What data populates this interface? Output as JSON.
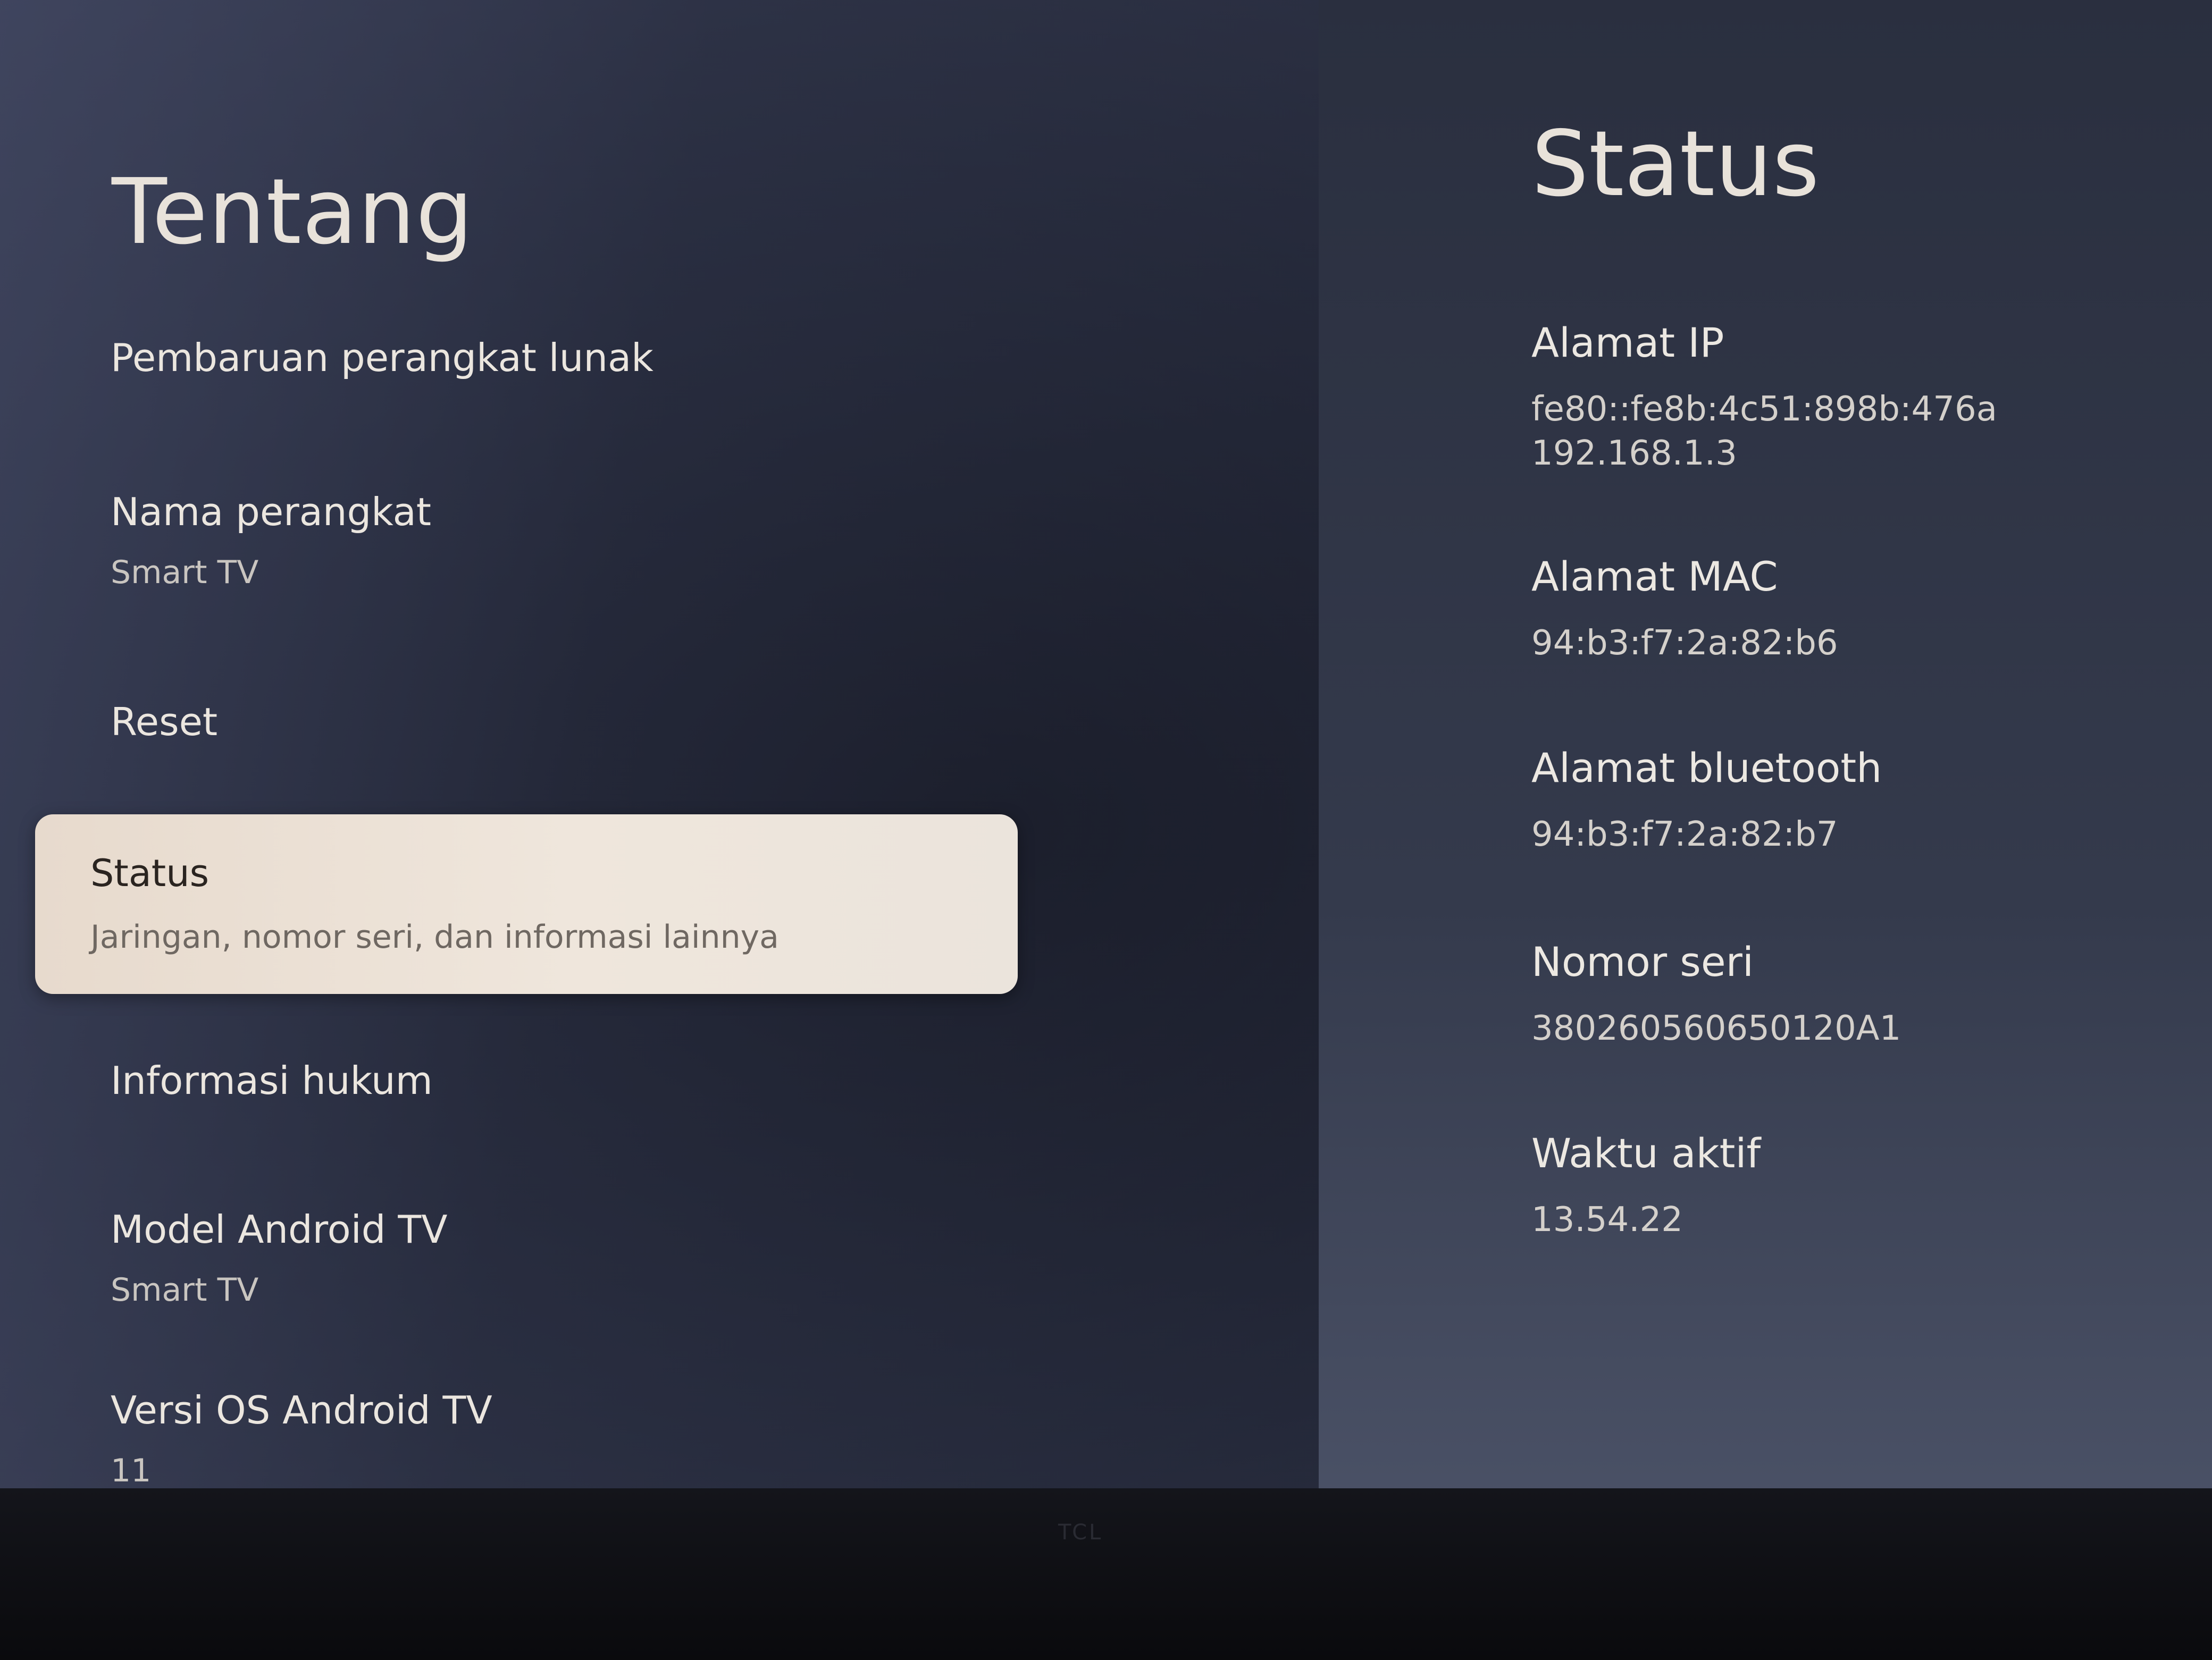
{
  "left": {
    "title": "Tentang",
    "items": [
      {
        "label": "Pembaruan perangkat lunak",
        "sub": ""
      },
      {
        "label": "Nama perangkat",
        "sub": "Smart TV"
      },
      {
        "label": "Reset",
        "sub": ""
      },
      {
        "label": "Status",
        "sub": "Jaringan, nomor seri, dan informasi lainnya",
        "selected": true
      },
      {
        "label": "Informasi hukum",
        "sub": ""
      },
      {
        "label": "Model Android TV",
        "sub": "Smart TV"
      },
      {
        "label": "Versi OS Android TV",
        "sub": "11"
      }
    ]
  },
  "right": {
    "title": "Status",
    "fields": [
      {
        "label": "Alamat IP",
        "values": [
          "fe80::fe8b:4c51:898b:476a",
          "192.168.1.3"
        ]
      },
      {
        "label": "Alamat MAC",
        "values": [
          "94:b3:f7:2a:82:b6"
        ]
      },
      {
        "label": "Alamat bluetooth",
        "values": [
          "94:b3:f7:2a:82:b7"
        ]
      },
      {
        "label": "Nomor seri",
        "values": [
          "380260560650120A1"
        ]
      },
      {
        "label": "Waktu aktif",
        "values": [
          "13.54.22"
        ]
      }
    ]
  },
  "bezel": {
    "brand": "TCL"
  }
}
